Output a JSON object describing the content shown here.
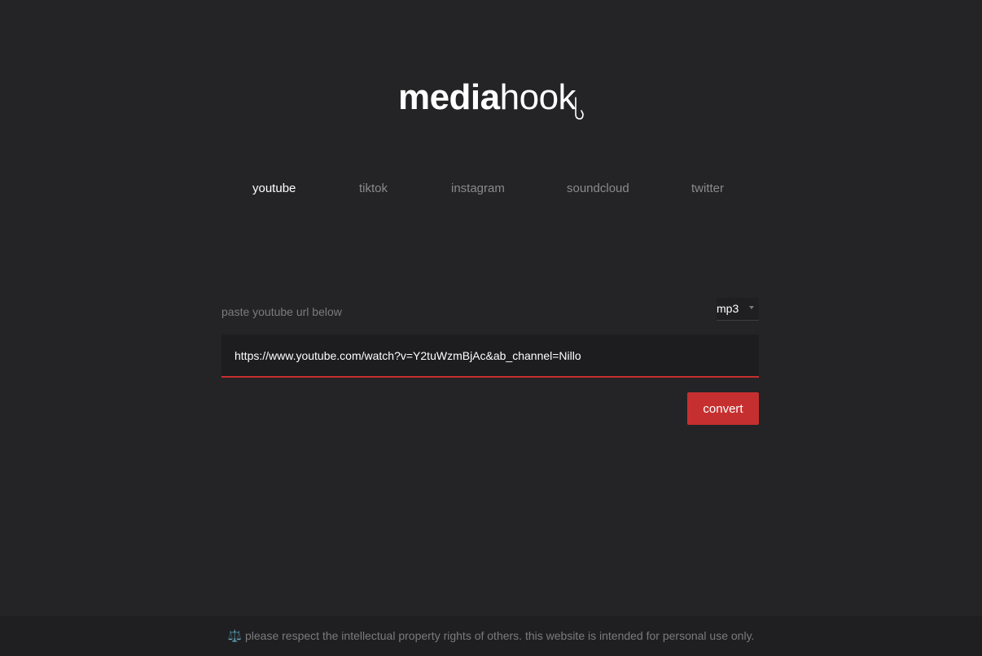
{
  "logo": {
    "part1": "media",
    "part2": "hook",
    "icon": "fish-hook-icon"
  },
  "tabs": [
    {
      "label": "youtube",
      "active": true
    },
    {
      "label": "tiktok",
      "active": false
    },
    {
      "label": "instagram",
      "active": false
    },
    {
      "label": "soundcloud",
      "active": false
    },
    {
      "label": "twitter",
      "active": false
    }
  ],
  "form": {
    "label": "paste youtube url below",
    "format": {
      "selected": "mp3",
      "icon": "caret-down-icon"
    },
    "url_value": "https://www.youtube.com/watch?v=Y2tuWzmBjAc&ab_channel=Nillo",
    "convert_label": "convert"
  },
  "footer": {
    "icon": "balance-scale-icon",
    "icon_glyph": "⚖️",
    "text": "please respect the intellectual property rights of others. this website is intended for personal use only."
  },
  "colors": {
    "background": "#242426",
    "accent": "#c62f2f",
    "footer_background": "#1f1f21"
  }
}
